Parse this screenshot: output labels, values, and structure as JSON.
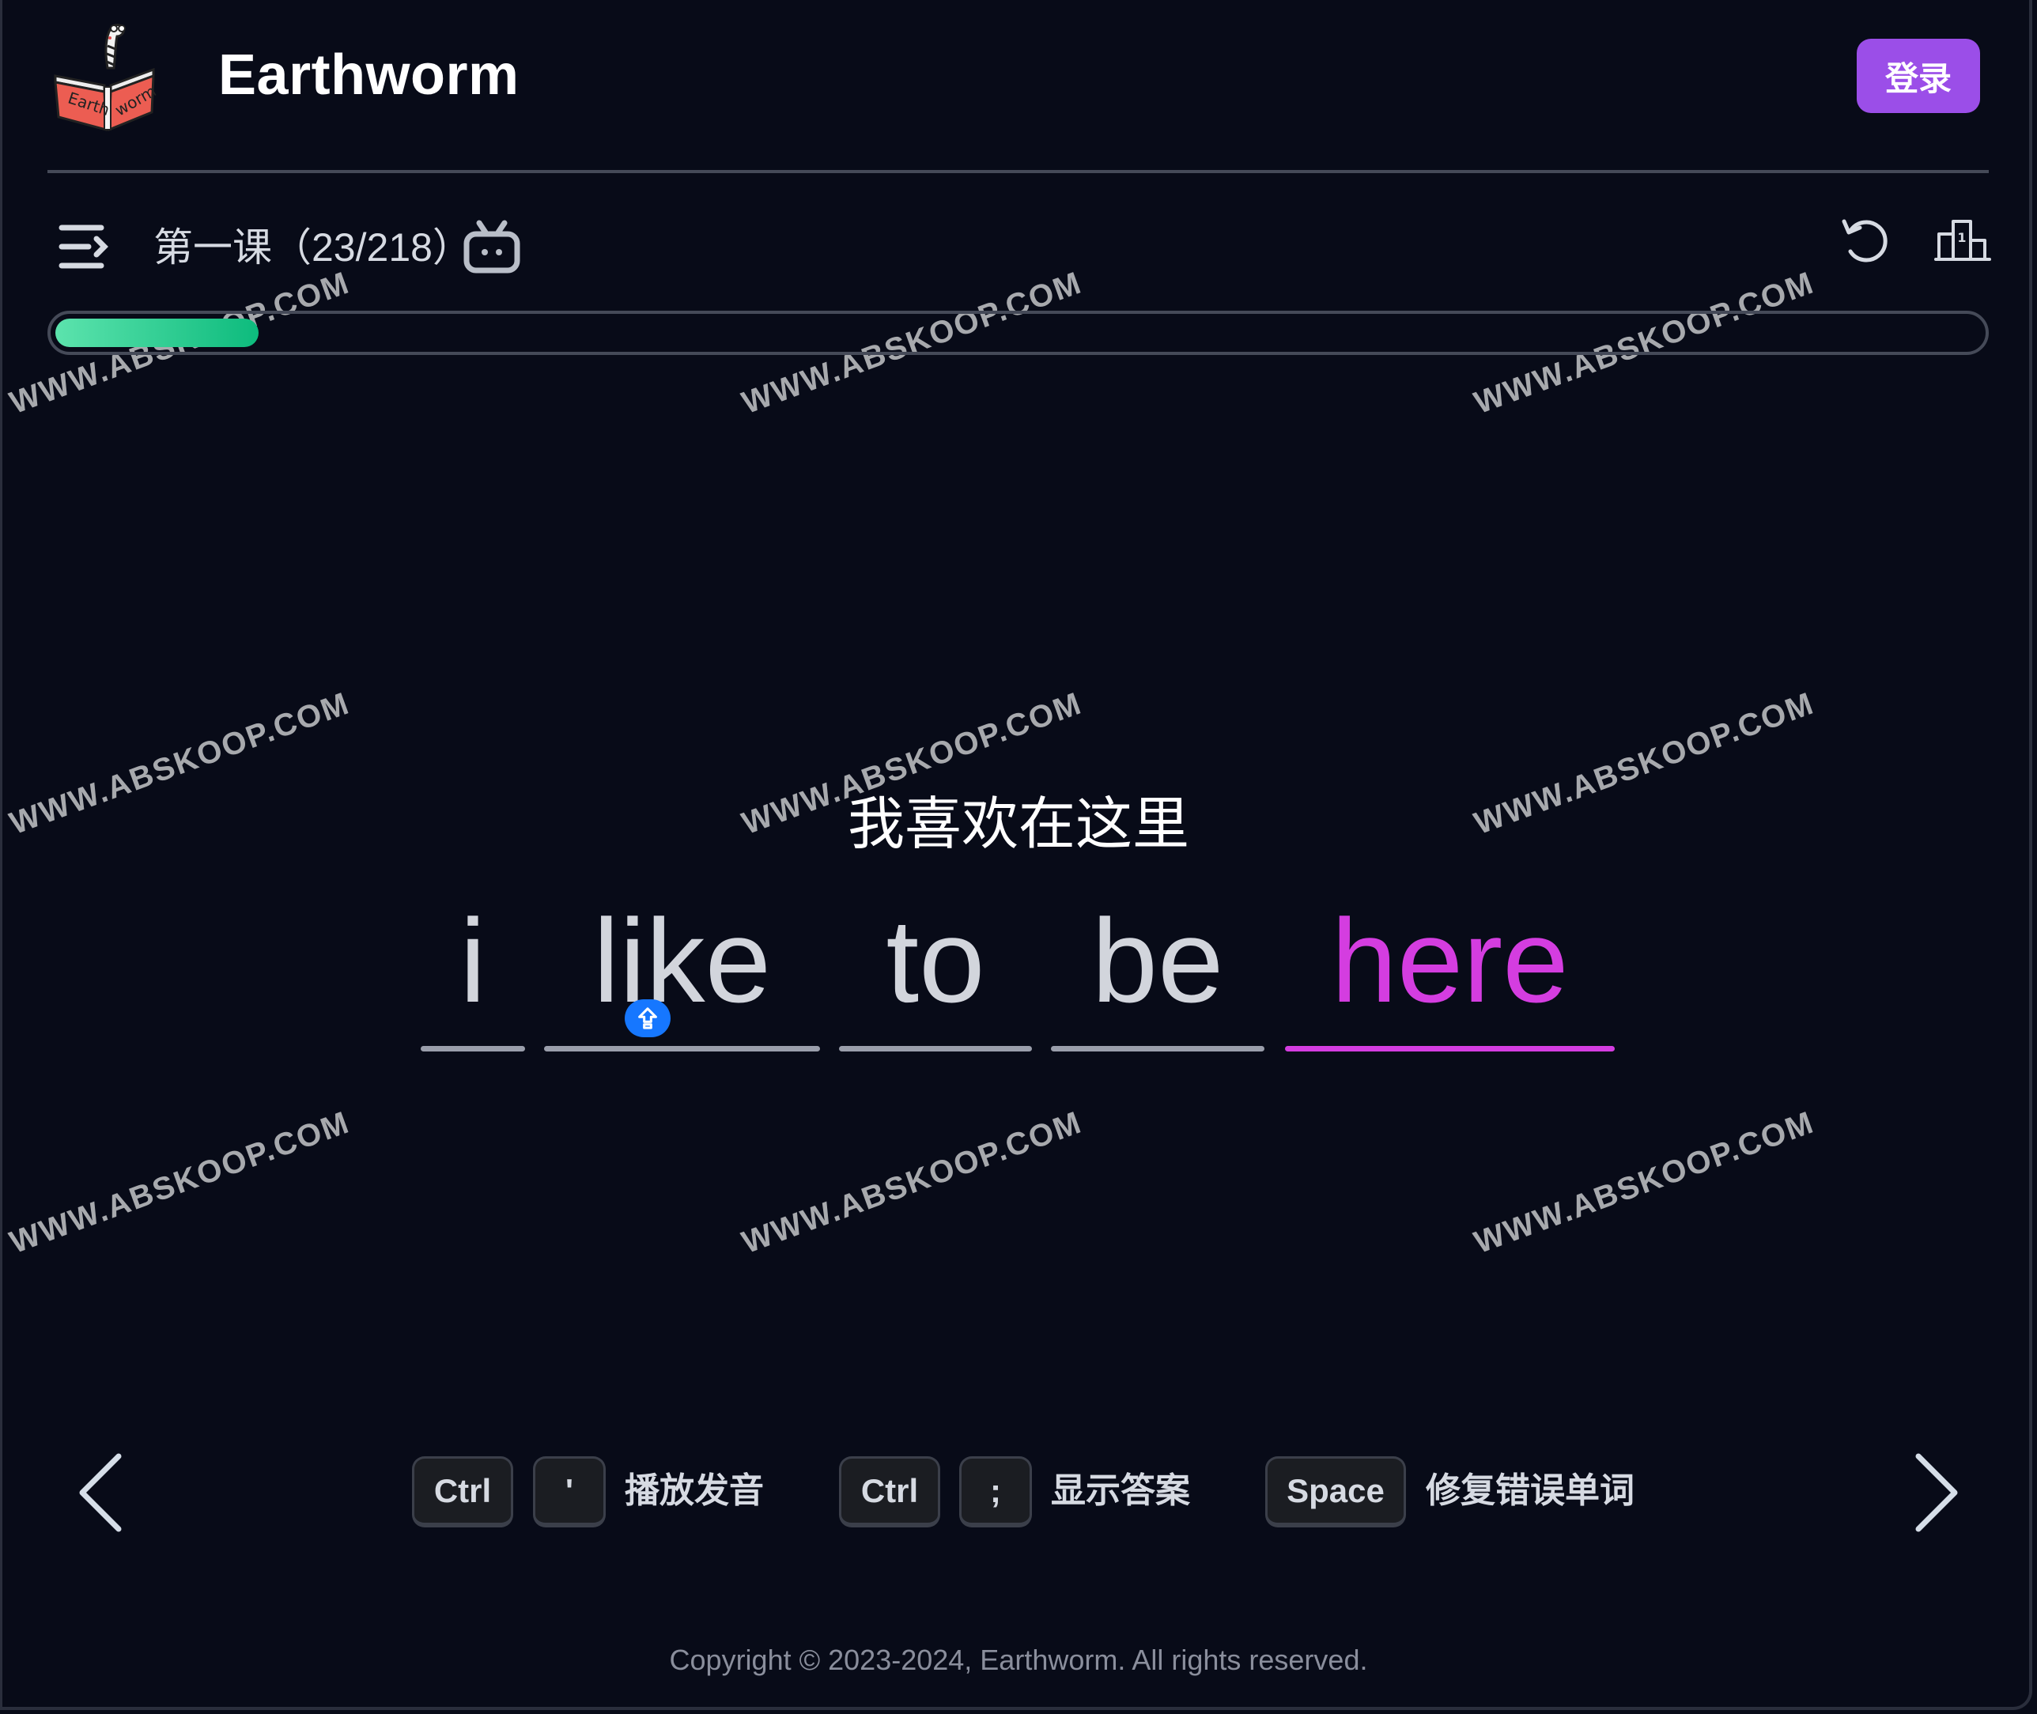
{
  "header": {
    "brand": "Earthworm",
    "login_label": "登录",
    "logo_text_left": "Earth",
    "logo_text_right": "worm"
  },
  "toolbar": {
    "lesson_title": "第一课（23/218）",
    "icons": [
      "menu-icon",
      "bilibili-tv-icon",
      "reset-icon",
      "leaderboard-icon"
    ]
  },
  "progress": {
    "current": 23,
    "total": 218,
    "fraction": 0.1055
  },
  "question": {
    "chinese": "我喜欢在这里",
    "words": [
      {
        "text": "i",
        "state": "done"
      },
      {
        "text": "like",
        "state": "done"
      },
      {
        "text": "to",
        "state": "done"
      },
      {
        "text": "be",
        "state": "done"
      },
      {
        "text": "here",
        "state": "active"
      }
    ],
    "caps_lock_indicator": "shift-icon"
  },
  "shortcuts": [
    {
      "keys": [
        "Ctrl",
        "'"
      ],
      "label": "播放发音"
    },
    {
      "keys": [
        "Ctrl",
        ";"
      ],
      "label": "显示答案"
    },
    {
      "keys": [
        "Space"
      ],
      "label": "修复错误单词"
    }
  ],
  "navigation": {
    "prev": "chevron-left-icon",
    "next": "chevron-right-icon"
  },
  "footer": {
    "copyright": "Copyright © 2023-2024, Earthworm. All rights reserved."
  },
  "watermark": "WWW.ABSKOOP.COM",
  "colors": {
    "background": "#080b18",
    "accent_purple": "#9b4ee8",
    "active_word": "#d43de0",
    "progress_start": "#5ce3ad",
    "progress_end": "#0dbb7d",
    "shift_badge": "#1677ff"
  }
}
